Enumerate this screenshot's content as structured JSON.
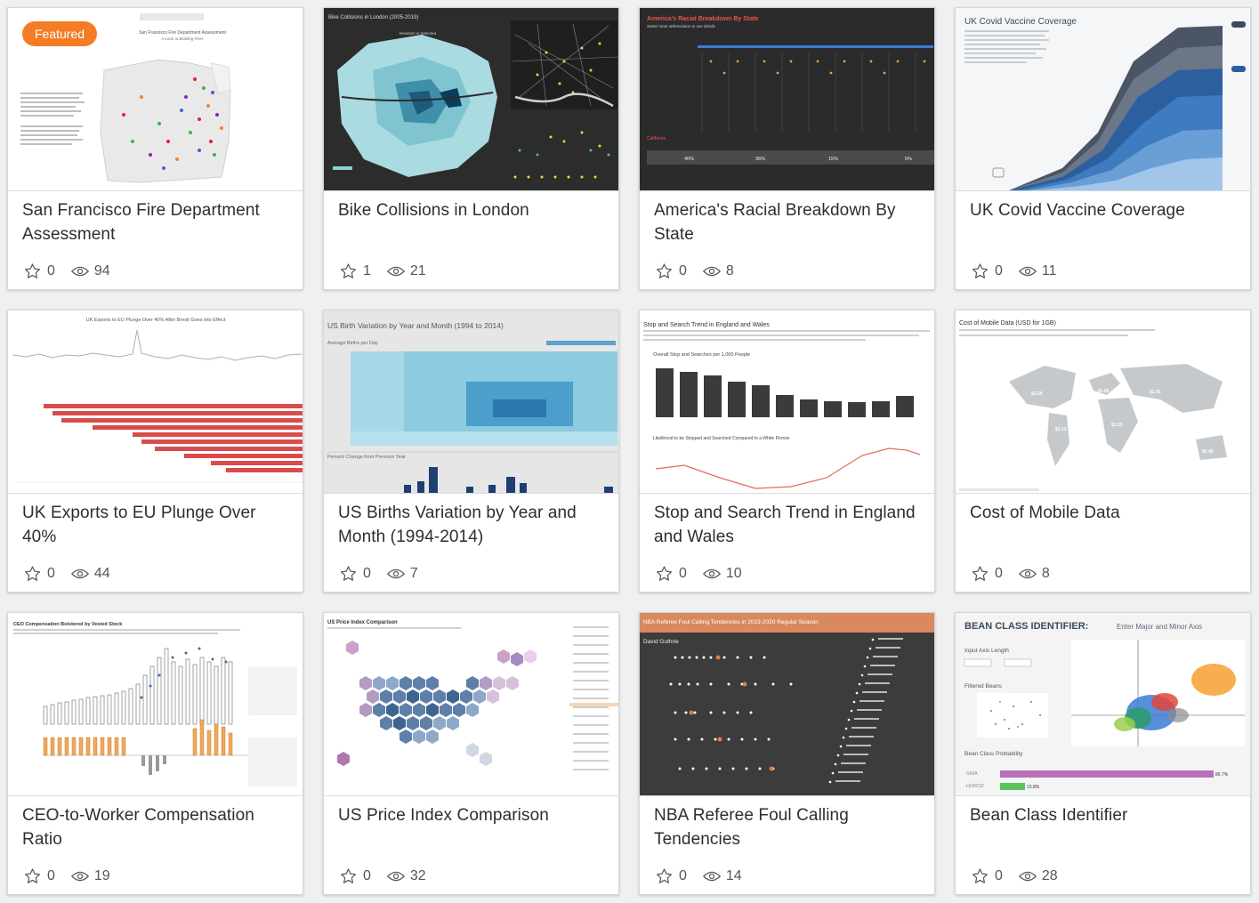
{
  "featured_badge": "Featured",
  "cards": [
    {
      "title": "San Francisco Fire Department Assessment",
      "stars": "0",
      "views": "94",
      "thumb_text": [
        "San Francisco Fire Department Assessment",
        "A Look at Building Fires"
      ]
    },
    {
      "title": "Bike Collisions in London",
      "stars": "1",
      "views": "21",
      "thumb_text": [
        "Bike Collisions in London (2005-2019)",
        "Newham is Selected"
      ]
    },
    {
      "title": "America's Racial Breakdown By State",
      "stars": "0",
      "views": "8",
      "thumb_text": [
        "America's Racial Breakdown By State",
        "Select state abbreviation to see details",
        "California",
        "40%",
        "36%",
        "15%",
        "5%"
      ]
    },
    {
      "title": "UK Covid Vaccine Coverage",
      "stars": "0",
      "views": "11",
      "thumb_text": [
        "UK Covid Vaccine Coverage"
      ]
    },
    {
      "title": "UK Exports to EU Plunge Over 40%",
      "stars": "0",
      "views": "44",
      "thumb_text": [
        "UK Exports to EU Plunge Over 40% After Brexit Goes into Effect"
      ]
    },
    {
      "title": "US Births Variation by Year and Month (1994-2014)",
      "stars": "0",
      "views": "7",
      "thumb_text": [
        "US Birth Variation by Year and Month (1994 to 2014)",
        "Average Births per Day",
        "Percent Change from Previous Year"
      ]
    },
    {
      "title": "Stop and Search Trend in England and Wales",
      "stars": "0",
      "views": "10",
      "thumb_text": [
        "Stop and Search Trend in England and Wales",
        "Overall Stop and Searches per 1,000 People",
        "Likelihood to be Stopped and Searched Compared to a White Person"
      ]
    },
    {
      "title": "Cost of Mobile Data",
      "stars": "0",
      "views": "8",
      "thumb_text": [
        "Cost of Mobile Data (USD for 1GB)",
        "$3.00",
        "$1.65",
        "$1.42",
        "$3.23",
        "$2.13",
        "$5.40"
      ]
    },
    {
      "title": "CEO-to-Worker Compensation Ratio",
      "stars": "0",
      "views": "19",
      "thumb_text": [
        "CEO Compensation Bolstered by Vested Stock"
      ]
    },
    {
      "title": "US Price Index Comparison",
      "stars": "0",
      "views": "32",
      "thumb_text": [
        "US Price Index Comparison"
      ]
    },
    {
      "title": "NBA Referee Foul Calling Tendencies",
      "stars": "0",
      "views": "14",
      "thumb_text": [
        "NBA Referee Foul Calling Tendencies in 2019-2020 Regular Season",
        "David Guthrie"
      ]
    },
    {
      "title": "Bean Class Identifier",
      "stars": "0",
      "views": "28",
      "thumb_text": [
        "BEAN CLASS IDENTIFIER:",
        "Enter Major and Minor Axis",
        "Input Axis Length",
        "Filtered Beans",
        "Bean Class Probability",
        "SIRA",
        "HOROZ",
        "86.7%",
        "10.8%"
      ]
    }
  ]
}
